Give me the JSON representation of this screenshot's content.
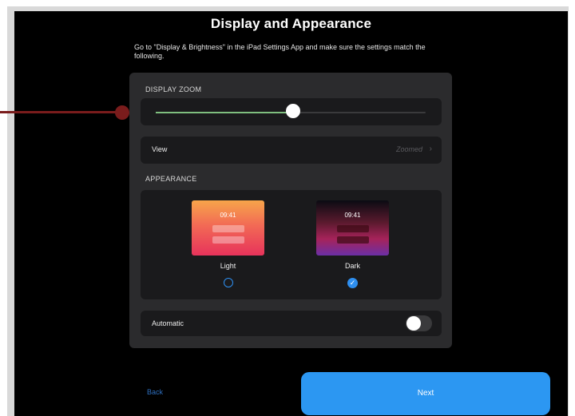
{
  "page": {
    "title": "Display and Appearance",
    "subtitle": "Go to \"Display & Brightness\" in the iPad Settings App and make sure the settings match the following."
  },
  "display_zoom": {
    "label": "DISPLAY ZOOM",
    "slider_value_percent": 51
  },
  "view_row": {
    "label": "View",
    "value": "Zoomed",
    "chevron": "›"
  },
  "appearance": {
    "label": "APPEARANCE",
    "options": [
      {
        "label": "Light",
        "time": "09:41",
        "selected": false
      },
      {
        "label": "Dark",
        "time": "09:41",
        "selected": true
      }
    ],
    "check_glyph": "✓"
  },
  "automatic": {
    "label": "Automatic",
    "enabled": false
  },
  "footer": {
    "back_label": "Back",
    "next_label": "Next"
  },
  "colors": {
    "accent": "#2c97f2",
    "annotation": "#7a1c1c",
    "slider_fill": "#7fbf7f"
  },
  "icons": [
    "chevron-right-icon",
    "checkmark-icon",
    "radio-empty-icon"
  ]
}
